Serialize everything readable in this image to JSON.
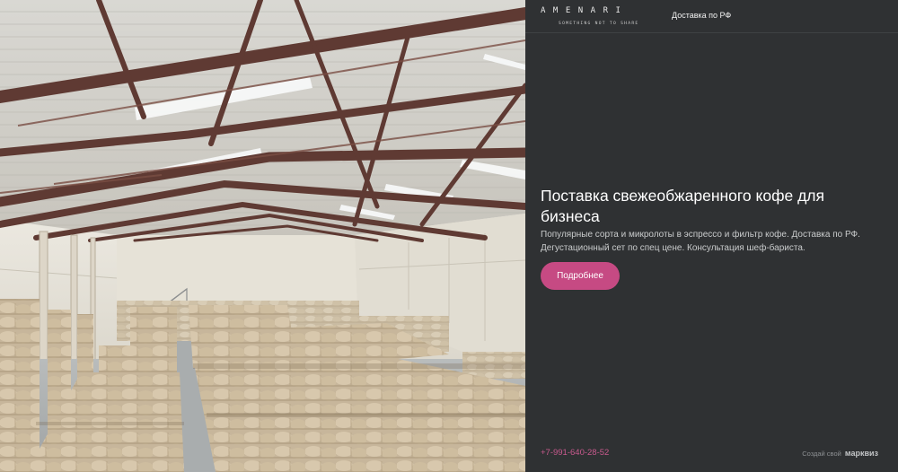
{
  "header": {
    "logo_text": "AMENARI",
    "logo_tagline": "SOMETHING NOT TO SHARE",
    "nav_link": "Доставка по РФ"
  },
  "hero": {
    "headline": "Поставка свежеобжаренного кофе для бизнеса",
    "description": "Популярные сорта и микролоты в эспрессо и фильтр кофе. Доставка по РФ. Дегустационный сет по спец цене. Консультация шеф-бариста.",
    "cta_label": "Подробнее",
    "image_alt": "warehouse-with-coffee-sacks"
  },
  "footer": {
    "phone": "+7-991-640-28-52",
    "credit_text": "Создай свой",
    "credit_brand": "марквиз"
  },
  "colors": {
    "panel_bg": "#2f3133",
    "accent": "#c64a83",
    "phone": "#c85a8e",
    "text": "#ffffff",
    "muted": "#c9cbcc"
  }
}
